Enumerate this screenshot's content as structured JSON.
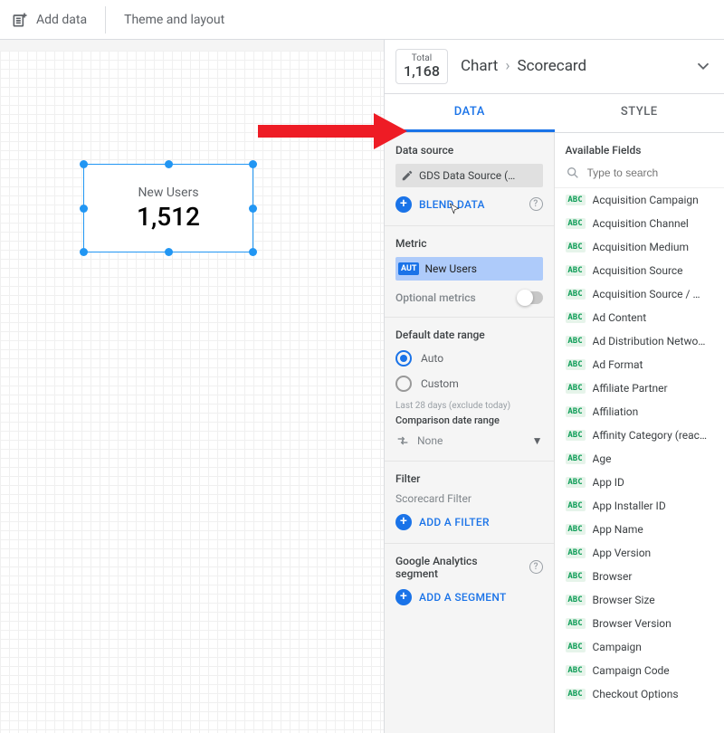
{
  "toolbar": {
    "add_data": "Add data",
    "theme_layout": "Theme and layout"
  },
  "canvas": {
    "scorecard": {
      "label": "New Users",
      "value": "1,512"
    }
  },
  "panel": {
    "total": {
      "label": "Total",
      "value": "1,168"
    },
    "breadcrumb": {
      "root": "Chart",
      "current": "Scorecard"
    },
    "tabs": {
      "data": "DATA",
      "style": "STYLE"
    }
  },
  "data_tab": {
    "data_source": {
      "title": "Data source",
      "name": "GDS Data Source (…",
      "blend": "BLEND DATA"
    },
    "metric": {
      "title": "Metric",
      "chip": {
        "agg": "AUT",
        "name": "New Users"
      },
      "optional": "Optional metrics"
    },
    "date_range": {
      "title": "Default date range",
      "auto": "Auto",
      "custom": "Custom",
      "note": "Last 28 days (exclude today)",
      "comparison_title": "Comparison date range",
      "comparison_value": "None"
    },
    "filter": {
      "title": "Filter",
      "sub": "Scorecard Filter",
      "add": "ADD A FILTER"
    },
    "segment": {
      "title": "Google Analytics segment",
      "add": "ADD A SEGMENT"
    }
  },
  "fields": {
    "title": "Available Fields",
    "search_placeholder": "Type to search",
    "items": [
      "Acquisition Campaign",
      "Acquisition Channel",
      "Acquisition Medium",
      "Acquisition Source",
      "Acquisition Source / …",
      "Ad Content",
      "Ad Distribution Netwo…",
      "Ad Format",
      "Affiliate Partner",
      "Affiliation",
      "Affinity Category (reac…",
      "Age",
      "App ID",
      "App Installer ID",
      "App Name",
      "App Version",
      "Browser",
      "Browser Size",
      "Browser Version",
      "Campaign",
      "Campaign Code",
      "Checkout Options"
    ]
  }
}
